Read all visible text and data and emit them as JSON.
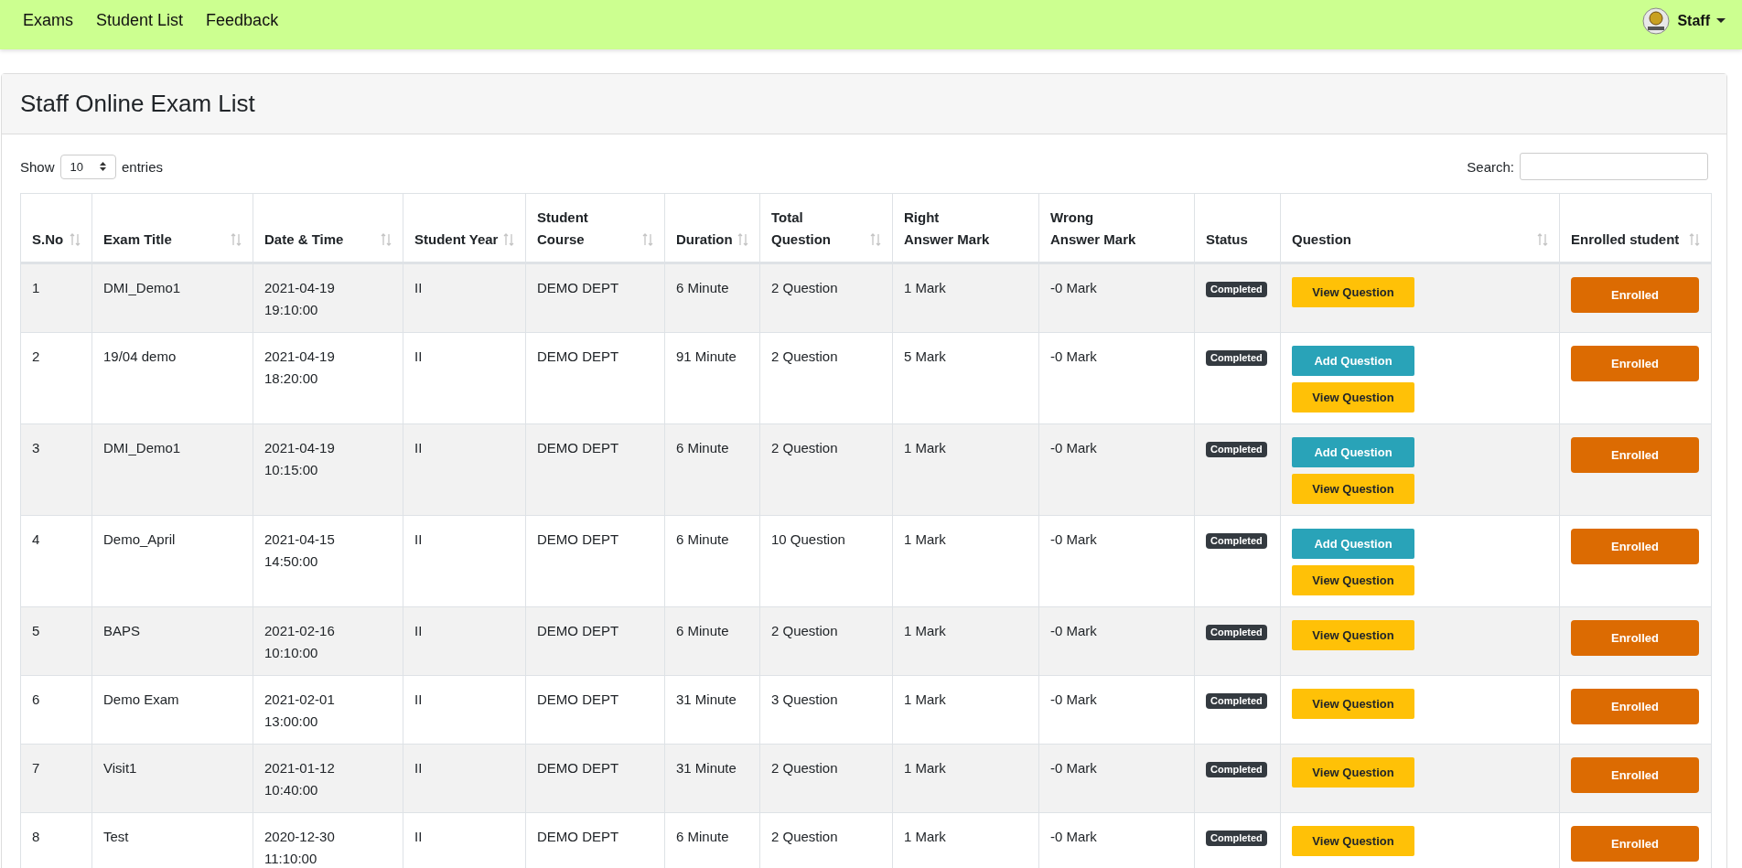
{
  "navbar": {
    "links": [
      "Exams",
      "Student List",
      "Feedback"
    ],
    "user": "Staff"
  },
  "card": {
    "title": "Staff Online Exam List"
  },
  "controls": {
    "show_label": "Show",
    "page_size": "10",
    "entries_label": "entries",
    "search_label": "Search:"
  },
  "table": {
    "columns": [
      {
        "label": "S.No",
        "sortable": true
      },
      {
        "label": "Exam Title",
        "sortable": true
      },
      {
        "label": "Date & Time",
        "sortable": true
      },
      {
        "label": "Student Year",
        "sortable": true
      },
      {
        "label": "Student Course",
        "sortable": true
      },
      {
        "label": "Duration",
        "sortable": true
      },
      {
        "label": "Total Question",
        "sortable": true
      },
      {
        "label": "Right Answer Mark",
        "sortable": false
      },
      {
        "label": "Wrong Answer Mark",
        "sortable": false
      },
      {
        "label": "Status",
        "sortable": false
      },
      {
        "label": "Question",
        "sortable": true
      },
      {
        "label": "Enrolled student",
        "sortable": true
      }
    ],
    "rows": [
      {
        "cells": [
          "1",
          "DMI_Demo1",
          "2021-04-19 19:10:00",
          "II",
          "DEMO DEPT",
          "6 Minute",
          "2 Question",
          "1 Mark",
          "-0 Mark"
        ],
        "status": "Completed",
        "buttons": [
          {
            "kind": "view",
            "label": "View Question"
          }
        ],
        "enrolled": "Enrolled"
      },
      {
        "cells": [
          "2",
          "19/04 demo",
          "2021-04-19 18:20:00",
          "II",
          "DEMO DEPT",
          "91 Minute",
          "2 Question",
          "5 Mark",
          "-0 Mark"
        ],
        "status": "Completed",
        "buttons": [
          {
            "kind": "add",
            "label": "Add Question"
          },
          {
            "kind": "view",
            "label": "View Question"
          }
        ],
        "enrolled": "Enrolled"
      },
      {
        "cells": [
          "3",
          "DMI_Demo1",
          "2021-04-19 10:15:00",
          "II",
          "DEMO DEPT",
          "6 Minute",
          "2 Question",
          "1 Mark",
          "-0 Mark"
        ],
        "status": "Completed",
        "buttons": [
          {
            "kind": "add",
            "label": "Add Question"
          },
          {
            "kind": "view",
            "label": "View Question"
          }
        ],
        "enrolled": "Enrolled"
      },
      {
        "cells": [
          "4",
          "Demo_April",
          "2021-04-15 14:50:00",
          "II",
          "DEMO DEPT",
          "6 Minute",
          "10 Question",
          "1 Mark",
          "-0 Mark"
        ],
        "status": "Completed",
        "buttons": [
          {
            "kind": "add",
            "label": "Add Question"
          },
          {
            "kind": "view",
            "label": "View Question"
          }
        ],
        "enrolled": "Enrolled"
      },
      {
        "cells": [
          "5",
          "BAPS",
          "2021-02-16 10:10:00",
          "II",
          "DEMO DEPT",
          "6 Minute",
          "2 Question",
          "1 Mark",
          "-0 Mark"
        ],
        "status": "Completed",
        "buttons": [
          {
            "kind": "view",
            "label": "View Question"
          }
        ],
        "enrolled": "Enrolled"
      },
      {
        "cells": [
          "6",
          "Demo Exam",
          "2021-02-01 13:00:00",
          "II",
          "DEMO DEPT",
          "31 Minute",
          "3 Question",
          "1 Mark",
          "-0 Mark"
        ],
        "status": "Completed",
        "buttons": [
          {
            "kind": "view",
            "label": "View Question"
          }
        ],
        "enrolled": "Enrolled"
      },
      {
        "cells": [
          "7",
          "Visit1",
          "2021-01-12 10:40:00",
          "II",
          "DEMO DEPT",
          "31 Minute",
          "2 Question",
          "1 Mark",
          "-0 Mark"
        ],
        "status": "Completed",
        "buttons": [
          {
            "kind": "view",
            "label": "View Question"
          }
        ],
        "enrolled": "Enrolled"
      },
      {
        "cells": [
          "8",
          "Test",
          "2020-12-30 11:10:00",
          "II",
          "DEMO DEPT",
          "6 Minute",
          "2 Question",
          "1 Mark",
          "-0 Mark"
        ],
        "status": "Completed",
        "buttons": [
          {
            "kind": "view",
            "label": "View Question"
          }
        ],
        "enrolled": "Enrolled"
      }
    ]
  }
}
